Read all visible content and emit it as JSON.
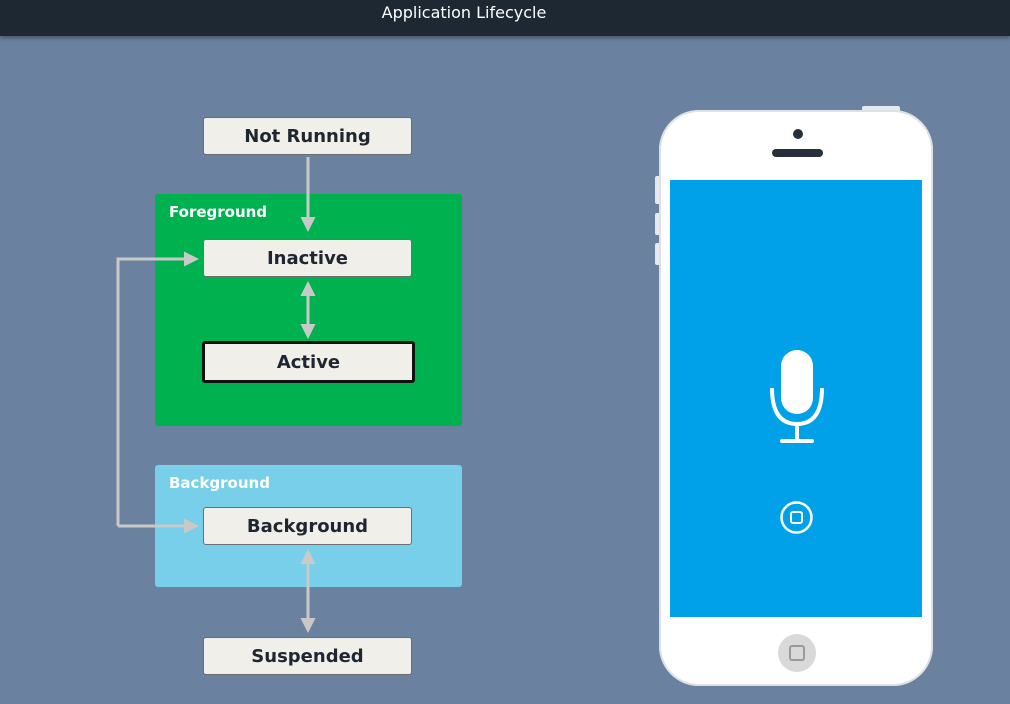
{
  "window": {
    "title": "Application Lifecycle"
  },
  "diagram": {
    "groups": {
      "foreground": "Foreground",
      "background": "Background"
    },
    "states": {
      "not_running": "Not Running",
      "inactive": "Inactive",
      "active": "Active",
      "background": "Background",
      "suspended": "Suspended"
    }
  },
  "phone": {
    "screen_icon": "microphone-icon",
    "screen_button_icon": "stop-button-icon",
    "home_button_icon": "home-button-icon"
  },
  "colors": {
    "page_background": "#6a819f",
    "title_bar": "#1e2832",
    "foreground_group": "#00b14f",
    "background_group": "#78cfe9",
    "state_box": "#f0efea",
    "arrow": "#c9c9c9",
    "phone_screen": "#00a1e9"
  }
}
